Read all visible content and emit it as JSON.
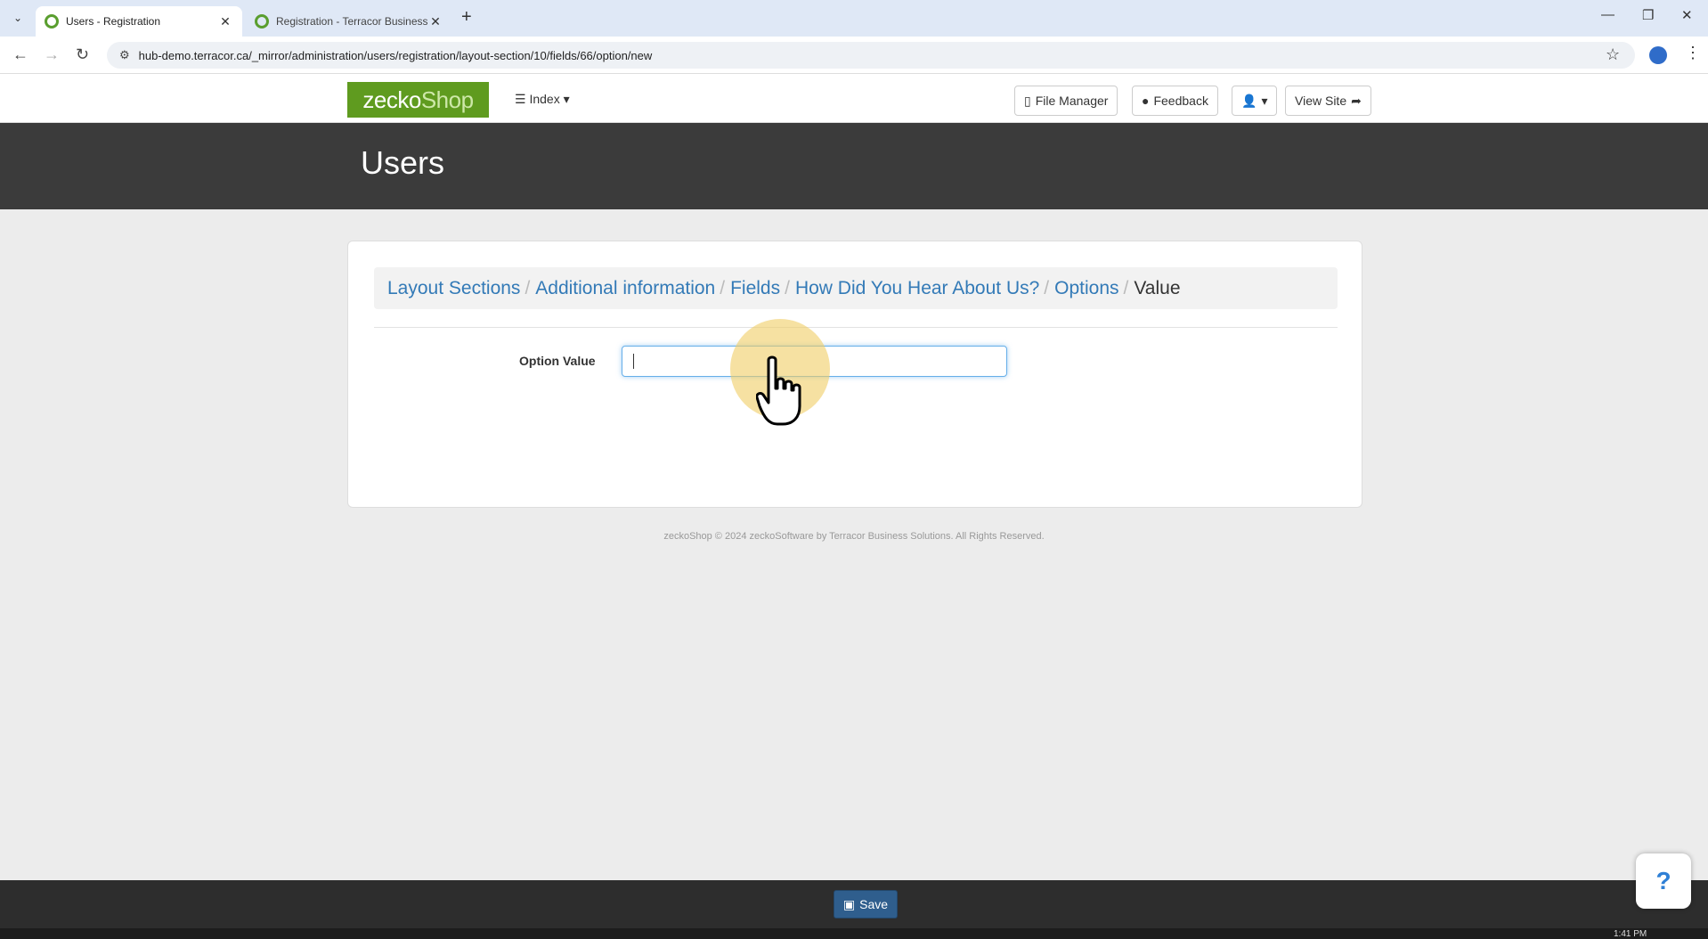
{
  "browser": {
    "tabs": [
      {
        "title": "Users - Registration",
        "active": true
      },
      {
        "title": "Registration - Terracor Business Solutions",
        "active": false
      }
    ],
    "url": "hub-demo.terracor.ca/_mirror/administration/users/registration/layout-section/10/fields/66/option/new"
  },
  "topnav": {
    "logo_text_a": "zecko",
    "logo_text_b": "Shop",
    "index_label": "Index",
    "file_manager_label": "File Manager",
    "feedback_label": "Feedback",
    "view_site_label": "View Site"
  },
  "header": {
    "title": "Users"
  },
  "breadcrumb": [
    {
      "label": "Layout Sections"
    },
    {
      "label": "Additional information"
    },
    {
      "label": "Fields"
    },
    {
      "label": "How Did You Hear About Us?"
    },
    {
      "label": "Options"
    },
    {
      "label": "Value"
    }
  ],
  "form": {
    "option_value_label": "Option Value",
    "option_value": ""
  },
  "footer": {
    "copyright": "zeckoShop © 2024 zeckoSoftware by Terracor Business Solutions. All Rights Reserved."
  },
  "savebar": {
    "save_label": "Save"
  },
  "help": {
    "label": "?"
  },
  "taskbar": {
    "clock": "1:41 PM"
  }
}
